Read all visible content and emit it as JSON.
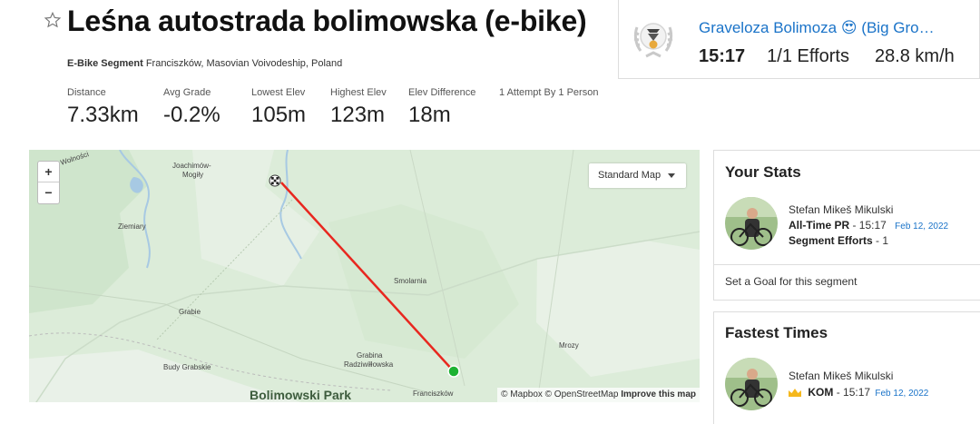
{
  "segment": {
    "title": "Leśna autostrada bolimowska (e-bike)",
    "type_label": "E-Bike Segment",
    "location": "Franciszków, Masovian Voivodeship, Poland"
  },
  "stats": [
    {
      "label": "Distance",
      "value": "7.33km"
    },
    {
      "label": "Avg Grade",
      "value": "-0.2%"
    },
    {
      "label": "Lowest Elev",
      "value": "105m"
    },
    {
      "label": "Highest Elev",
      "value": "123m"
    },
    {
      "label": "Elev Difference",
      "value": "18m"
    },
    {
      "label": "1 Attempt By 1 Person",
      "value": ""
    }
  ],
  "leader": {
    "athlete": "Graveloza Bolimoza 😍 (Big Gro…",
    "time": "15:17",
    "efforts": "1/1 Efforts",
    "speed": "28.8 km/h"
  },
  "map": {
    "zoom_in": "+",
    "zoom_out": "−",
    "style_label": "Standard Map",
    "park": "Bolimowski Park",
    "attribution_prefix": "© Mapbox © OpenStreetMap",
    "attribution_link": "Improve this map",
    "places": [
      {
        "name": "Wolności"
      },
      {
        "name": "Joachimów-"
      },
      {
        "name": "Mogiły"
      },
      {
        "name": "Ziemiary"
      },
      {
        "name": "Smolarnia"
      },
      {
        "name": "Grabie"
      },
      {
        "name": "Grabina"
      },
      {
        "name": "Radziwiłłowska"
      },
      {
        "name": "Budy Grabskie"
      },
      {
        "name": "Mrozy"
      },
      {
        "name": "Franciszków"
      }
    ],
    "route_color": "#e8271f",
    "start_color": "#1db233"
  },
  "your_stats": {
    "heading": "Your Stats",
    "name": "Stefan Mikeš Mikulski",
    "pr_label": "All-Time PR",
    "pr_value": "- 15:17",
    "pr_date": "Feb 12, 2022",
    "efforts_label": "Segment Efforts",
    "efforts_value": "- 1",
    "goal_link": "Set a Goal for this segment"
  },
  "fastest": {
    "heading": "Fastest Times",
    "name": "Stefan Mikeš Mikulski",
    "kom_label": "KOM",
    "kom_value": "- 15:17",
    "kom_date": "Feb 12, 2022"
  },
  "colors": {
    "link": "#1a73c8",
    "kom_crown": "#f5b81d"
  }
}
